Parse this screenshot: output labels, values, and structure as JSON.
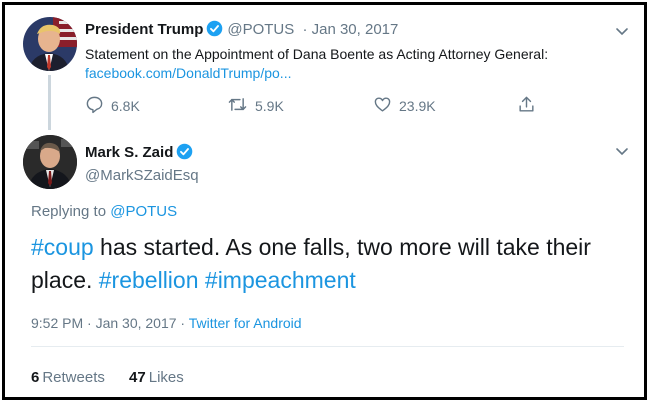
{
  "parent_tweet": {
    "author_name": "President Trump",
    "handle": "@POTUS",
    "date": "· Jan 30, 2017",
    "text": "Statement on the Appointment of Dana Boente as Acting Attorney General:",
    "link": "facebook.com/DonaldTrump/po...",
    "replies": "6.8K",
    "retweets": "5.9K",
    "likes": "23.9K"
  },
  "reply_tweet": {
    "author_name": "Mark S. Zaid",
    "handle": "@MarkSZaidEsq",
    "replying_prefix": "Replying to ",
    "replying_to": "@POTUS",
    "hashtag_coup": "#coup",
    "text_middle": " has started. As one falls, two more will take their place. ",
    "hashtag_rebellion": "#rebellion",
    "hashtag_impeachment": "#impeachment",
    "timestamp": "9:52 PM · Jan 30, 2017 · ",
    "source": "Twitter for Android",
    "retweet_count": "6",
    "retweet_label": "Retweets",
    "like_count": "47",
    "like_label": "Likes"
  },
  "colors": {
    "accent": "#1b95e0",
    "secondary_text": "#657786",
    "primary_text": "#14171a",
    "verified": "#1da1f2",
    "border": "#000000"
  },
  "icons": [
    "verified-icon",
    "chevron-down-icon",
    "reply-icon",
    "retweet-icon",
    "like-icon",
    "share-icon"
  ]
}
